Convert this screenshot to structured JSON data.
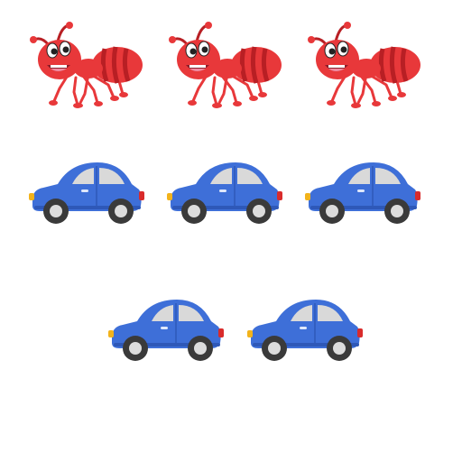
{
  "scene": {
    "groups": [
      {
        "kind": "ant",
        "count": 3
      },
      {
        "kind": "car",
        "count": 5
      }
    ]
  },
  "colors": {
    "ant_body": "#e8383a",
    "ant_stripe": "#b81f24",
    "ant_mouth": "#8a1e2a",
    "car_body": "#3e6fd8",
    "car_window": "#d9d9d9",
    "tire": "#3a3a3a",
    "hubcap": "#dcdcdc",
    "headlight": "#f2b31b",
    "taillight": "#d92b2b"
  }
}
